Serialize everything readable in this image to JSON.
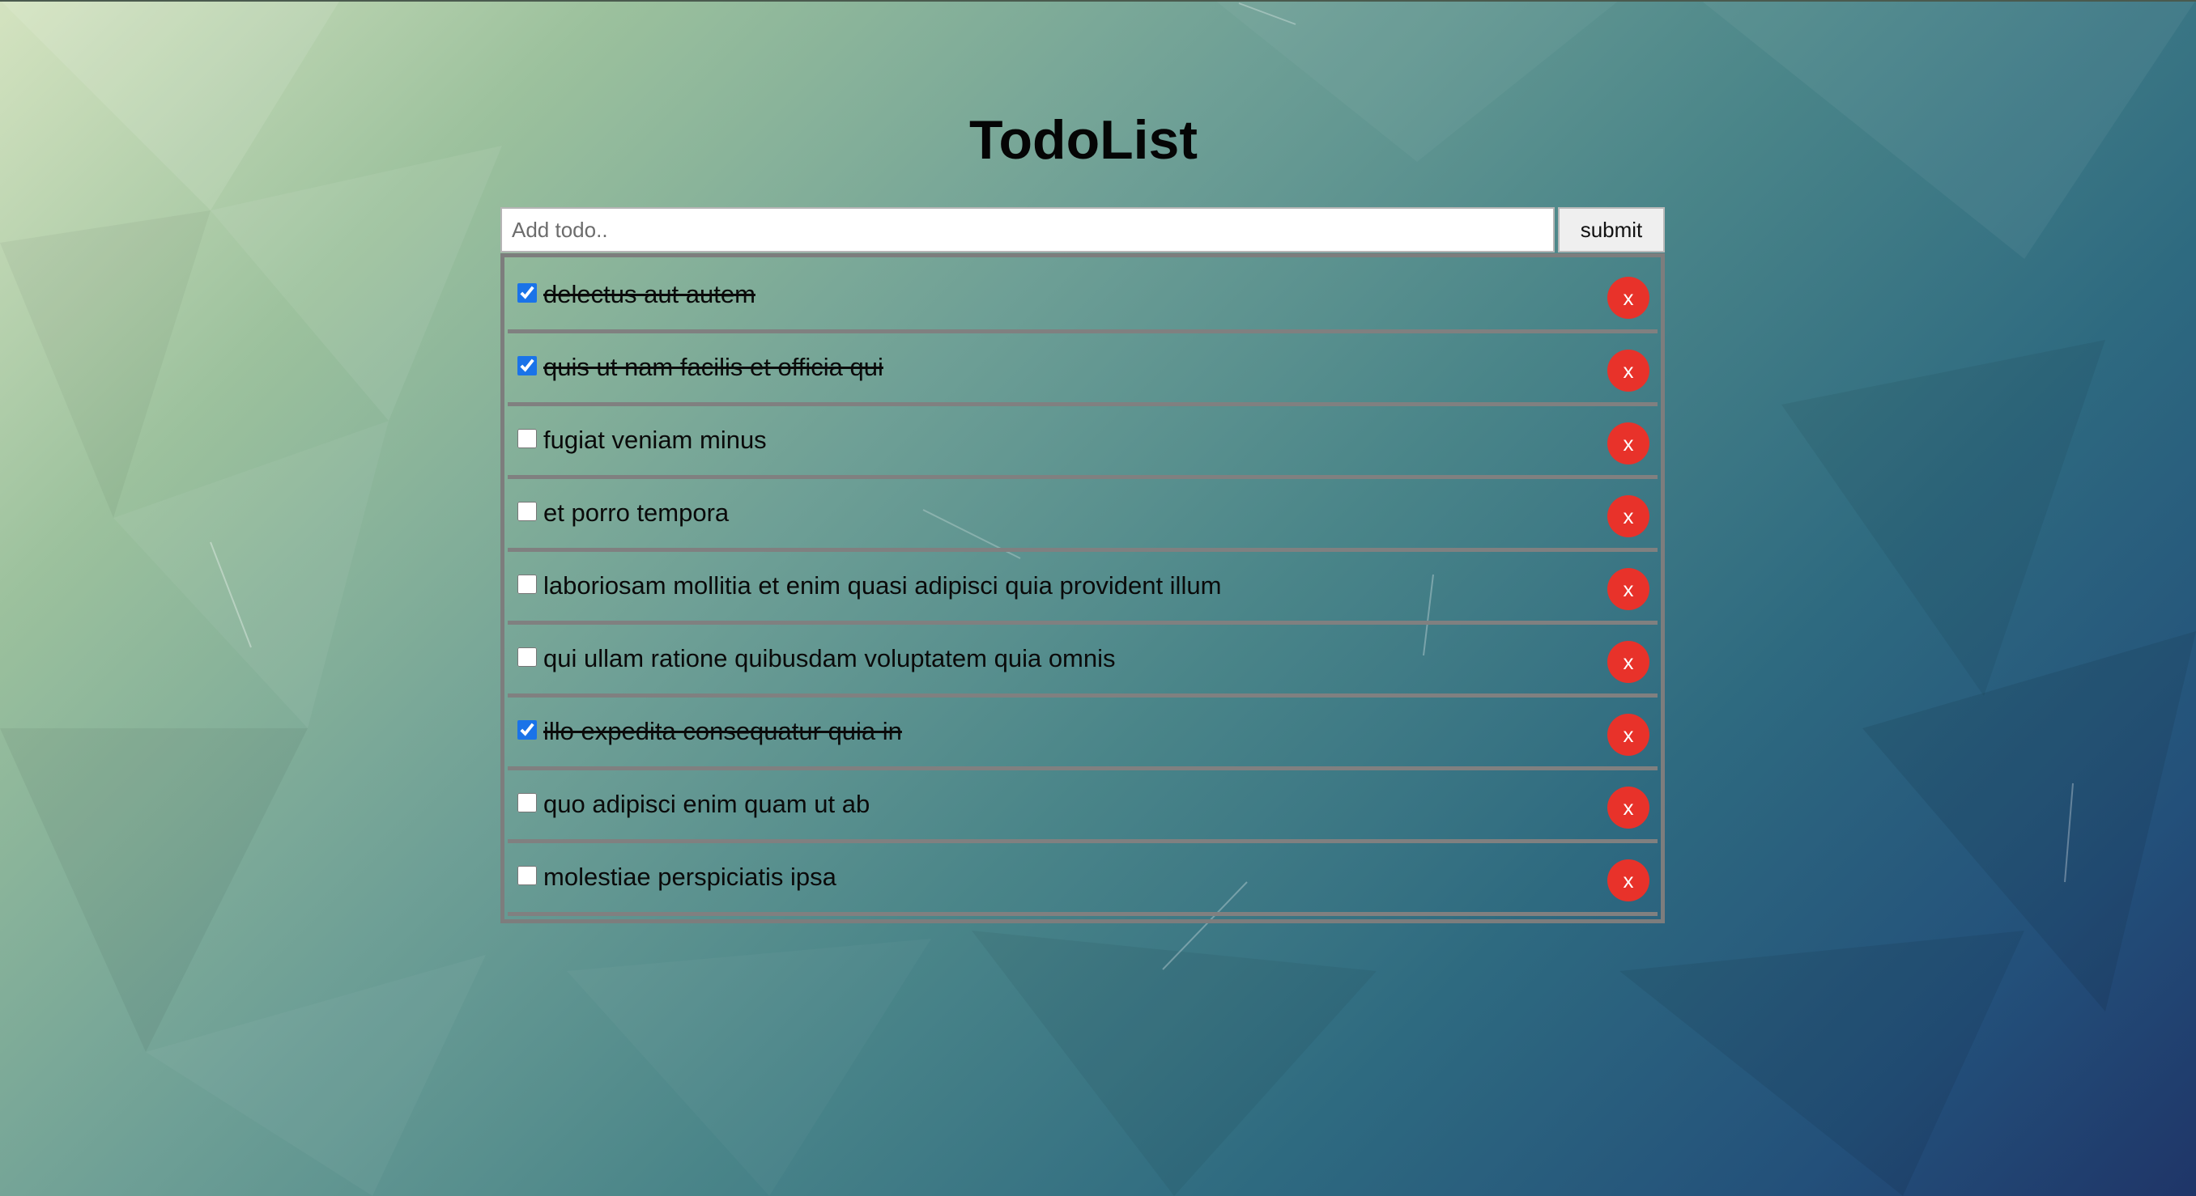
{
  "title": "TodoList",
  "form": {
    "placeholder": "Add todo..",
    "value": "",
    "submit_label": "submit"
  },
  "delete_label": "x",
  "todos": [
    {
      "text": "delectus aut autem",
      "completed": true
    },
    {
      "text": "quis ut nam facilis et officia qui",
      "completed": true
    },
    {
      "text": "fugiat veniam minus",
      "completed": false
    },
    {
      "text": "et porro tempora",
      "completed": false
    },
    {
      "text": "laboriosam mollitia et enim quasi adipisci quia provident illum",
      "completed": false
    },
    {
      "text": "qui ullam ratione quibusdam voluptatem quia omnis",
      "completed": false
    },
    {
      "text": "illo expedita consequatur quia in",
      "completed": true
    },
    {
      "text": "quo adipisci enim quam ut ab",
      "completed": false
    },
    {
      "text": "molestiae perspiciatis ipsa",
      "completed": false
    }
  ],
  "colors": {
    "delete_button": "#e8322a",
    "item_border": "#808080",
    "checkbox_accent": "#1a73e8"
  }
}
